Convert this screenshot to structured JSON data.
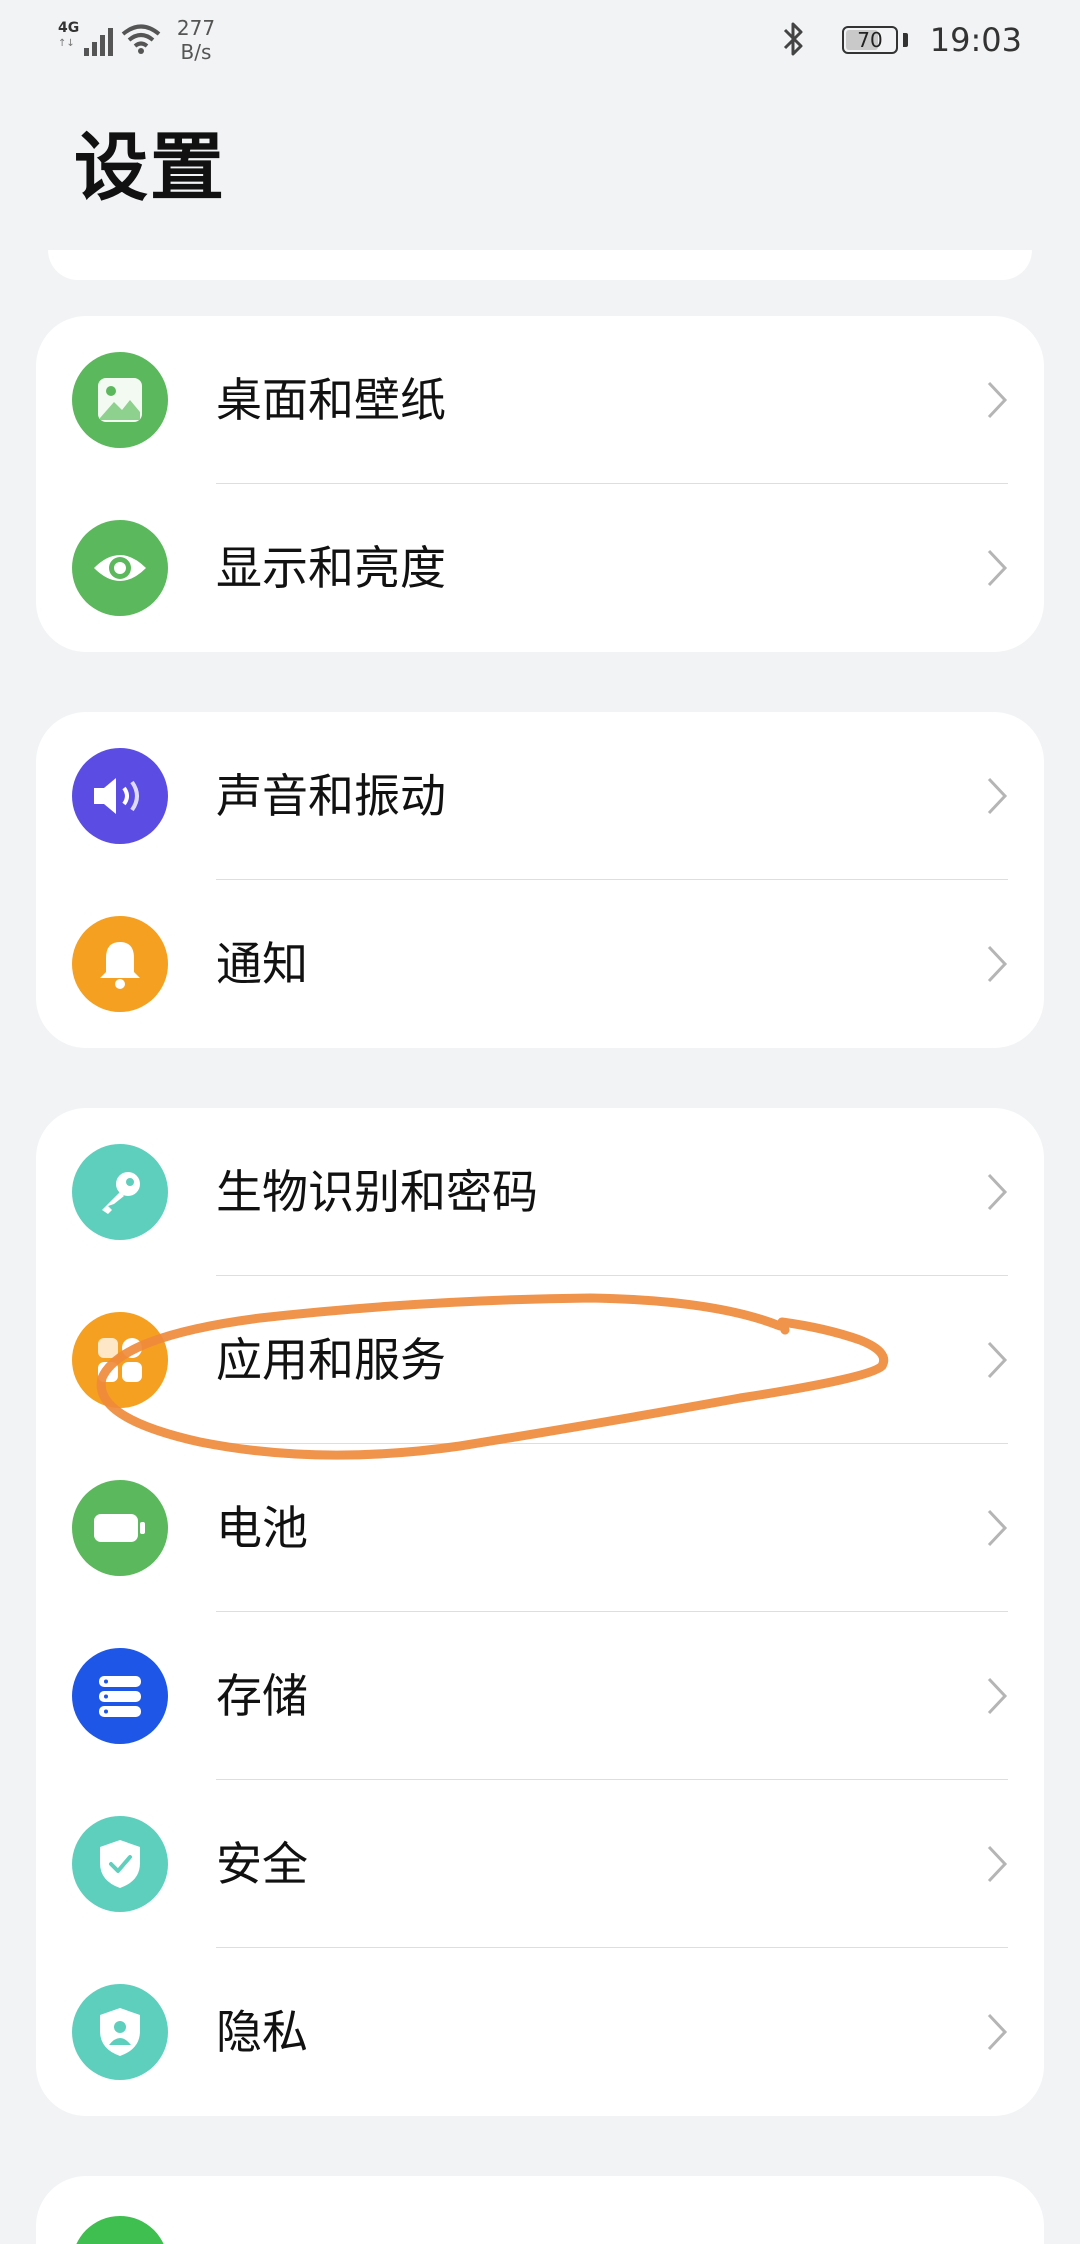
{
  "status_bar": {
    "network": "4G",
    "speed_value": "277",
    "speed_unit": "B/s",
    "battery": "70",
    "battery_level": 0.7,
    "time": "19:03"
  },
  "page": {
    "title": "设置"
  },
  "groups": [
    [
      {
        "label": "桌面和壁纸",
        "icon": "wallpaper-icon",
        "color": "#5cb85c"
      },
      {
        "label": "显示和亮度",
        "icon": "eye-icon",
        "color": "#5cb85c"
      }
    ],
    [
      {
        "label": "声音和振动",
        "icon": "speaker-icon",
        "color": "#5b4de3"
      },
      {
        "label": "通知",
        "icon": "bell-icon",
        "color": "#f5a020"
      }
    ],
    [
      {
        "label": "生物识别和密码",
        "icon": "key-icon",
        "color": "#5fcfbd"
      },
      {
        "label": "应用和服务",
        "icon": "apps-icon",
        "color": "#f5a020"
      },
      {
        "label": "电池",
        "icon": "battery-icon",
        "color": "#5cb85c"
      },
      {
        "label": "存储",
        "icon": "storage-icon",
        "color": "#1e56e8"
      },
      {
        "label": "安全",
        "icon": "shield-icon",
        "color": "#5fcfbd"
      },
      {
        "label": "隐私",
        "icon": "privacy-icon",
        "color": "#5fcfbd"
      }
    ],
    [
      {
        "label": "",
        "icon": "settings-item-icon",
        "color": "#3fbf4f"
      }
    ]
  ],
  "annotation": {
    "color": "#ef8a3c"
  }
}
